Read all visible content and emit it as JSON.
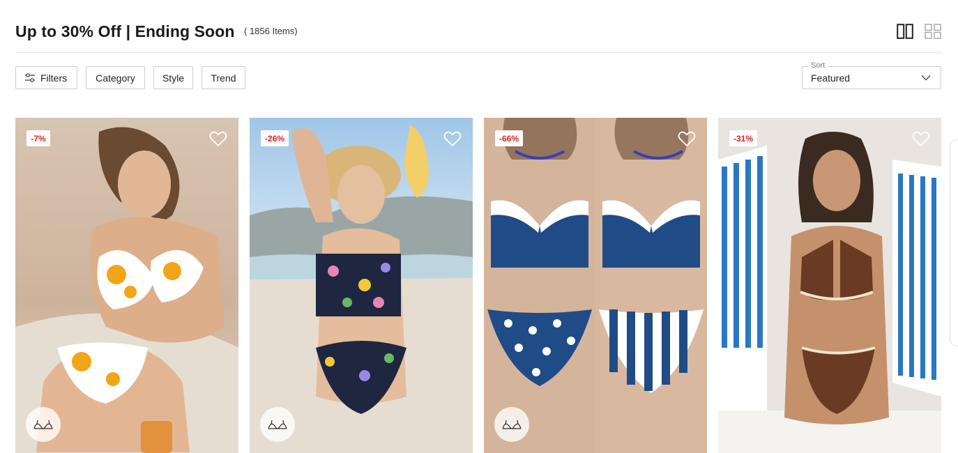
{
  "page": {
    "title": "Up to 30% Off | Ending Soon",
    "item_count": "( 1856 Items)"
  },
  "view_toggle": {
    "two_column_icon": "two-column-grid-icon",
    "four_column_icon": "four-column-grid-icon"
  },
  "toolbar": {
    "filters_label": "Filters",
    "filters_icon": "sliders-icon",
    "category_label": "Category",
    "style_label": "Style",
    "trend_label": "Trend"
  },
  "sort": {
    "label": "Sort",
    "value": "Featured",
    "icon": "chevron-down-icon"
  },
  "products": [
    {
      "discount": "-7%",
      "wishlist_icon": "heart-icon",
      "fit_icon": "bikini-top-icon",
      "image": "woman in yellow and white floral bikini on beach"
    },
    {
      "discount": "-26%",
      "wishlist_icon": "heart-icon",
      "fit_icon": "bikini-top-icon",
      "image": "woman in navy floral bandeau bikini with straw hat"
    },
    {
      "discount": "-66%",
      "wishlist_icon": "heart-icon",
      "fit_icon": "bikini-top-icon",
      "image": "navy underwire bikini tops with polka dot and striped bottoms"
    },
    {
      "discount": "-31%",
      "wishlist_icon": "heart-icon",
      "image": "woman in brown halter bikini with cream trim"
    }
  ],
  "colors": {
    "discount_text": "#e02020",
    "border": "#cfcfcf",
    "divider": "#e2e2e2"
  }
}
